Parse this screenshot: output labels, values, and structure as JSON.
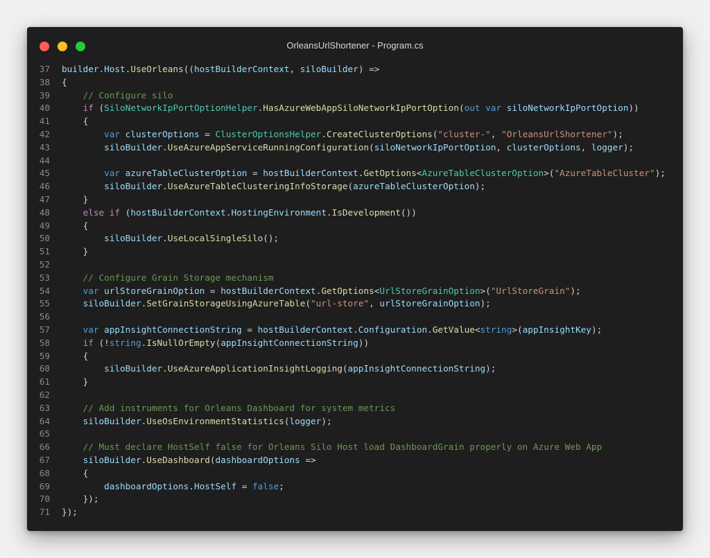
{
  "window": {
    "title": "OrleansUrlShortener - Program.cs",
    "buttons": {
      "close_color": "#ff5f57",
      "minimize_color": "#febc2e",
      "zoom_color": "#28c840"
    }
  },
  "syntax_colors": {
    "plain": "#d4d4d4",
    "variable": "#9cdcfe",
    "keyword": "#569cd6",
    "control": "#c586c0",
    "type": "#4ec9b0",
    "function": "#dcdcaa",
    "string": "#ce9178",
    "comment": "#6a9955"
  },
  "code": [
    {
      "n": "37",
      "indent": 0,
      "tokens": [
        [
          "var",
          "builder"
        ],
        [
          "plain",
          "."
        ],
        [
          "var",
          "Host"
        ],
        [
          "plain",
          "."
        ],
        [
          "fn",
          "UseOrleans"
        ],
        [
          "plain",
          "(("
        ],
        [
          "var",
          "hostBuilderContext"
        ],
        [
          "plain",
          ", "
        ],
        [
          "var",
          "siloBuilder"
        ],
        [
          "plain",
          ") =>"
        ]
      ]
    },
    {
      "n": "38",
      "indent": 0,
      "tokens": [
        [
          "plain",
          "{"
        ]
      ]
    },
    {
      "n": "39",
      "indent": 4,
      "tokens": [
        [
          "com",
          "// Configure silo"
        ]
      ]
    },
    {
      "n": "40",
      "indent": 4,
      "tokens": [
        [
          "ctrl",
          "if"
        ],
        [
          "plain",
          " ("
        ],
        [
          "type",
          "SiloNetworkIpPortOptionHelper"
        ],
        [
          "plain",
          "."
        ],
        [
          "fn",
          "HasAzureWebAppSiloNetworkIpPortOption"
        ],
        [
          "plain",
          "("
        ],
        [
          "kw",
          "out"
        ],
        [
          "plain",
          " "
        ],
        [
          "kw",
          "var"
        ],
        [
          "plain",
          " "
        ],
        [
          "var",
          "siloNetworkIpPortOption"
        ],
        [
          "plain",
          "))"
        ]
      ]
    },
    {
      "n": "41",
      "indent": 4,
      "tokens": [
        [
          "plain",
          "{"
        ]
      ]
    },
    {
      "n": "42",
      "indent": 8,
      "tokens": [
        [
          "kw",
          "var"
        ],
        [
          "plain",
          " "
        ],
        [
          "var",
          "clusterOptions"
        ],
        [
          "plain",
          " = "
        ],
        [
          "type",
          "ClusterOptionsHelper"
        ],
        [
          "plain",
          "."
        ],
        [
          "fn",
          "CreateClusterOptions"
        ],
        [
          "plain",
          "("
        ],
        [
          "str",
          "\"cluster-\""
        ],
        [
          "plain",
          ", "
        ],
        [
          "str",
          "\"OrleansUrlShortener\""
        ],
        [
          "plain",
          ");"
        ]
      ]
    },
    {
      "n": "43",
      "indent": 8,
      "tokens": [
        [
          "var",
          "siloBuilder"
        ],
        [
          "plain",
          "."
        ],
        [
          "fn",
          "UseAzureAppServiceRunningConfiguration"
        ],
        [
          "plain",
          "("
        ],
        [
          "var",
          "siloNetworkIpPortOption"
        ],
        [
          "plain",
          ", "
        ],
        [
          "var",
          "clusterOptions"
        ],
        [
          "plain",
          ", "
        ],
        [
          "var",
          "logger"
        ],
        [
          "plain",
          ");"
        ]
      ]
    },
    {
      "n": "44",
      "indent": 0,
      "tokens": []
    },
    {
      "n": "45",
      "indent": 8,
      "tokens": [
        [
          "kw",
          "var"
        ],
        [
          "plain",
          " "
        ],
        [
          "var",
          "azureTableClusterOption"
        ],
        [
          "plain",
          " = "
        ],
        [
          "var",
          "hostBuilderContext"
        ],
        [
          "plain",
          "."
        ],
        [
          "fn",
          "GetOptions"
        ],
        [
          "plain",
          "<"
        ],
        [
          "type",
          "AzureTableClusterOption"
        ],
        [
          "plain",
          ">("
        ],
        [
          "str",
          "\"AzureTableCluster\""
        ],
        [
          "plain",
          ");"
        ]
      ]
    },
    {
      "n": "46",
      "indent": 8,
      "tokens": [
        [
          "var",
          "siloBuilder"
        ],
        [
          "plain",
          "."
        ],
        [
          "fn",
          "UseAzureTableClusteringInfoStorage"
        ],
        [
          "plain",
          "("
        ],
        [
          "var",
          "azureTableClusterOption"
        ],
        [
          "plain",
          ");"
        ]
      ]
    },
    {
      "n": "47",
      "indent": 4,
      "tokens": [
        [
          "plain",
          "}"
        ]
      ]
    },
    {
      "n": "48",
      "indent": 4,
      "tokens": [
        [
          "ctrl",
          "else"
        ],
        [
          "plain",
          " "
        ],
        [
          "ctrl",
          "if"
        ],
        [
          "plain",
          " ("
        ],
        [
          "var",
          "hostBuilderContext"
        ],
        [
          "plain",
          "."
        ],
        [
          "var",
          "HostingEnvironment"
        ],
        [
          "plain",
          "."
        ],
        [
          "fn",
          "IsDevelopment"
        ],
        [
          "plain",
          "())"
        ]
      ]
    },
    {
      "n": "49",
      "indent": 4,
      "tokens": [
        [
          "plain",
          "{"
        ]
      ]
    },
    {
      "n": "50",
      "indent": 8,
      "tokens": [
        [
          "var",
          "siloBuilder"
        ],
        [
          "plain",
          "."
        ],
        [
          "fn",
          "UseLocalSingleSilo"
        ],
        [
          "plain",
          "();"
        ]
      ]
    },
    {
      "n": "51",
      "indent": 4,
      "tokens": [
        [
          "plain",
          "}"
        ]
      ]
    },
    {
      "n": "52",
      "indent": 0,
      "tokens": []
    },
    {
      "n": "53",
      "indent": 4,
      "tokens": [
        [
          "com",
          "// Configure Grain Storage mechanism"
        ]
      ]
    },
    {
      "n": "54",
      "indent": 4,
      "tokens": [
        [
          "kw",
          "var"
        ],
        [
          "plain",
          " "
        ],
        [
          "var",
          "urlStoreGrainOption"
        ],
        [
          "plain",
          " = "
        ],
        [
          "var",
          "hostBuilderContext"
        ],
        [
          "plain",
          "."
        ],
        [
          "fn",
          "GetOptions"
        ],
        [
          "plain",
          "<"
        ],
        [
          "type",
          "UrlStoreGrainOption"
        ],
        [
          "plain",
          ">("
        ],
        [
          "str",
          "\"UrlStoreGrain\""
        ],
        [
          "plain",
          ");"
        ]
      ]
    },
    {
      "n": "55",
      "indent": 4,
      "tokens": [
        [
          "var",
          "siloBuilder"
        ],
        [
          "plain",
          "."
        ],
        [
          "fn",
          "SetGrainStorageUsingAzureTable"
        ],
        [
          "plain",
          "("
        ],
        [
          "str",
          "\"url-store\""
        ],
        [
          "plain",
          ", "
        ],
        [
          "var",
          "urlStoreGrainOption"
        ],
        [
          "plain",
          ");"
        ]
      ]
    },
    {
      "n": "56",
      "indent": 0,
      "tokens": []
    },
    {
      "n": "57",
      "indent": 4,
      "tokens": [
        [
          "kw",
          "var"
        ],
        [
          "plain",
          " "
        ],
        [
          "var",
          "appInsightConnectionString"
        ],
        [
          "plain",
          " = "
        ],
        [
          "var",
          "hostBuilderContext"
        ],
        [
          "plain",
          "."
        ],
        [
          "var",
          "Configuration"
        ],
        [
          "plain",
          "."
        ],
        [
          "fn",
          "GetValue"
        ],
        [
          "plain",
          "<"
        ],
        [
          "kw",
          "string"
        ],
        [
          "plain",
          ">("
        ],
        [
          "var",
          "appInsightKey"
        ],
        [
          "plain",
          ");"
        ]
      ]
    },
    {
      "n": "58",
      "indent": 4,
      "tokens": [
        [
          "ctrl",
          "if"
        ],
        [
          "plain",
          " (!"
        ],
        [
          "kw",
          "string"
        ],
        [
          "plain",
          "."
        ],
        [
          "fn",
          "IsNullOrEmpty"
        ],
        [
          "plain",
          "("
        ],
        [
          "var",
          "appInsightConnectionString"
        ],
        [
          "plain",
          "))"
        ]
      ]
    },
    {
      "n": "59",
      "indent": 4,
      "tokens": [
        [
          "plain",
          "{"
        ]
      ]
    },
    {
      "n": "60",
      "indent": 8,
      "tokens": [
        [
          "var",
          "siloBuilder"
        ],
        [
          "plain",
          "."
        ],
        [
          "fn",
          "UseAzureApplicationInsightLogging"
        ],
        [
          "plain",
          "("
        ],
        [
          "var",
          "appInsightConnectionString"
        ],
        [
          "plain",
          ");"
        ]
      ]
    },
    {
      "n": "61",
      "indent": 4,
      "tokens": [
        [
          "plain",
          "}"
        ]
      ]
    },
    {
      "n": "62",
      "indent": 0,
      "tokens": []
    },
    {
      "n": "63",
      "indent": 4,
      "tokens": [
        [
          "com",
          "// Add instruments for Orleans Dashboard for system metrics"
        ]
      ]
    },
    {
      "n": "64",
      "indent": 4,
      "tokens": [
        [
          "var",
          "siloBuilder"
        ],
        [
          "plain",
          "."
        ],
        [
          "fn",
          "UseOsEnvironmentStatistics"
        ],
        [
          "plain",
          "("
        ],
        [
          "var",
          "logger"
        ],
        [
          "plain",
          ");"
        ]
      ]
    },
    {
      "n": "65",
      "indent": 0,
      "tokens": []
    },
    {
      "n": "66",
      "indent": 4,
      "tokens": [
        [
          "com",
          "// Must declare HostSelf false for Orleans Silo Host load DashboardGrain properly on Azure Web App"
        ]
      ]
    },
    {
      "n": "67",
      "indent": 4,
      "tokens": [
        [
          "var",
          "siloBuilder"
        ],
        [
          "plain",
          "."
        ],
        [
          "fn",
          "UseDashboard"
        ],
        [
          "plain",
          "("
        ],
        [
          "var",
          "dashboardOptions"
        ],
        [
          "plain",
          " =>"
        ]
      ]
    },
    {
      "n": "68",
      "indent": 4,
      "tokens": [
        [
          "plain",
          "{"
        ]
      ]
    },
    {
      "n": "69",
      "indent": 8,
      "tokens": [
        [
          "var",
          "dashboardOptions"
        ],
        [
          "plain",
          "."
        ],
        [
          "var",
          "HostSelf"
        ],
        [
          "plain",
          " = "
        ],
        [
          "kw",
          "false"
        ],
        [
          "plain",
          ";"
        ]
      ]
    },
    {
      "n": "70",
      "indent": 4,
      "tokens": [
        [
          "plain",
          "});"
        ]
      ]
    },
    {
      "n": "71",
      "indent": 0,
      "tokens": [
        [
          "plain",
          "});"
        ]
      ]
    }
  ]
}
